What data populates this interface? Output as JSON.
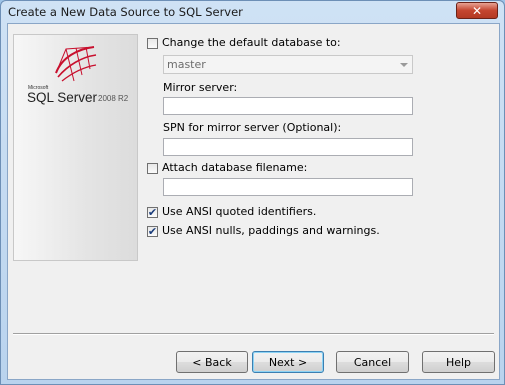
{
  "window": {
    "title": "Create a New Data Source to SQL Server",
    "close_glyph": "✕"
  },
  "banner": {
    "brand_small": "Microsoft",
    "product": "SQL Server",
    "version": "2008 R2",
    "logo_icon": "sql-server-logo-icon",
    "logo_color": "#c8102e"
  },
  "form": {
    "change_default_db": {
      "label": "Change the default database to:",
      "checked": false
    },
    "database_combo": {
      "value": "master"
    },
    "mirror_server": {
      "label": "Mirror server:",
      "value": ""
    },
    "spn_mirror": {
      "label": "SPN for mirror server (Optional):",
      "value": ""
    },
    "attach_db": {
      "label": "Attach database filename:",
      "checked": false
    },
    "attach_db_file": {
      "value": ""
    },
    "ansi_quoted": {
      "label": "Use ANSI quoted identifiers.",
      "checked": true
    },
    "ansi_nulls": {
      "label": "Use ANSI nulls, paddings and warnings.",
      "checked": true
    }
  },
  "buttons": {
    "back": "< Back",
    "next": "Next >",
    "cancel": "Cancel",
    "help": "Help"
  },
  "check_glyph": "✔"
}
